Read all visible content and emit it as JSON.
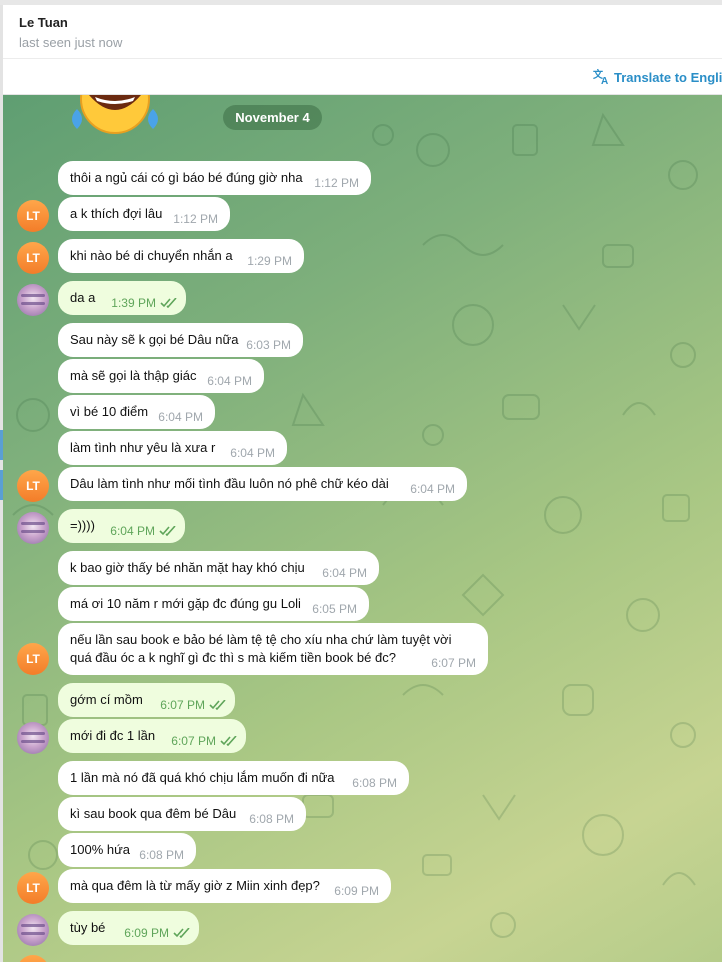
{
  "header": {
    "name": "Le Tuan",
    "status": "last seen just now"
  },
  "translate_bar": {
    "label": "Translate to English"
  },
  "chat": {
    "date": "November 4",
    "contact_initials": "LT",
    "messages": [
      {
        "text": "thôi a ngủ cái có gì báo bé đúng giờ nha",
        "time": "1:12 PM",
        "dir": "in"
      },
      {
        "text": "a k thích đợi lâu",
        "time": "1:12 PM",
        "dir": "in"
      },
      {
        "text": "khi nào bé di chuyển nhắn a",
        "time": "1:29 PM",
        "dir": "in"
      },
      {
        "text": "da a",
        "time": "1:39 PM",
        "dir": "out"
      },
      {
        "text": "Sau này sẽ k gọi bé Dâu nữa",
        "time": "6:03 PM",
        "dir": "in"
      },
      {
        "text": "mà sẽ gọi là thập giác",
        "time": "6:04 PM",
        "dir": "in"
      },
      {
        "text": "vì bé 10 điểm",
        "time": "6:04 PM",
        "dir": "in"
      },
      {
        "text": "làm tình như yêu là xưa r",
        "time": "6:04 PM",
        "dir": "in"
      },
      {
        "text": "Dâu làm tình như mối tình đầu luôn nó phê chữ kéo dài",
        "time": "6:04 PM",
        "dir": "in"
      },
      {
        "text": "=))))",
        "time": "6:04 PM",
        "dir": "out"
      },
      {
        "text": "k bao giờ thấy bé nhăn mặt hay khó chịu",
        "time": "6:04 PM",
        "dir": "in"
      },
      {
        "text": "má ơi 10 năm r mới gặp đc đúng gu Loli",
        "time": "6:05 PM",
        "dir": "in"
      },
      {
        "text": "nếu lần sau book e bảo bé làm tệ tệ cho xíu nha chứ làm tuyệt vời",
        "text2": "quá đầu óc a k nghĩ gì đc thì s mà kiếm tiền book bé đc?",
        "time": "6:07 PM",
        "dir": "in"
      },
      {
        "text": "gớm cí mồm",
        "time": "6:07 PM",
        "dir": "out"
      },
      {
        "text": "mới đi đc 1 lần",
        "time": "6:07 PM",
        "dir": "out"
      },
      {
        "text": "1 lần mà nó đã quá khó chịu lắm muốn đi nữa",
        "time": "6:08 PM",
        "dir": "in"
      },
      {
        "text": "kì sau book qua đêm bé Dâu",
        "time": "6:08 PM",
        "dir": "in"
      },
      {
        "text": "100% hứa",
        "time": "6:08 PM",
        "dir": "in"
      },
      {
        "text": "mà qua đêm là từ mấy giờ z Miin xinh đẹp?",
        "time": "6:09 PM",
        "dir": "in"
      },
      {
        "text": "tùy bé",
        "time": "6:09 PM",
        "dir": "out"
      }
    ]
  },
  "colors": {
    "accent": "#2a8ec7",
    "outgoing_bubble": "#effdde",
    "outgoing_time": "#5fa55a",
    "avatar_orange": "#f58a35"
  }
}
